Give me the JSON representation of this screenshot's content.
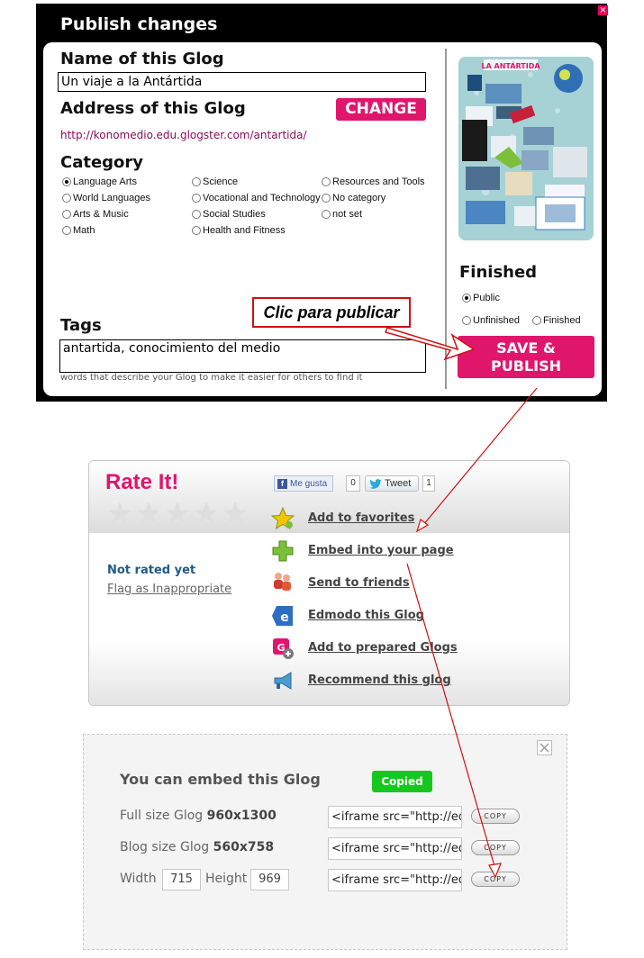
{
  "publish": {
    "title": "Publish changes",
    "close": "×",
    "name_heading": "Name of this Glog",
    "name_value": "Un viaje a la Antártida",
    "address_heading": "Address of this Glog",
    "change_label": "CHANGE",
    "address_url": "http://konomedio.edu.glogster.com/antartida/",
    "category_heading": "Category",
    "categories": [
      {
        "label": "Language Arts",
        "selected": true
      },
      {
        "label": "Science",
        "selected": false
      },
      {
        "label": "Resources and Tools",
        "selected": false
      },
      {
        "label": "World Languages",
        "selected": false
      },
      {
        "label": "Vocational and Technology",
        "selected": false
      },
      {
        "label": "No category",
        "selected": false
      },
      {
        "label": "Arts & Music",
        "selected": false
      },
      {
        "label": "Social Studies",
        "selected": false
      },
      {
        "label": "not set",
        "selected": false
      },
      {
        "label": "Math",
        "selected": false
      },
      {
        "label": "Health and Fitness",
        "selected": false
      }
    ],
    "thumbnail_title": "LA ANTÁRTIDA",
    "finished_heading": "Finished",
    "finished_options": [
      {
        "label": "Public",
        "selected": true
      },
      {
        "label": "Unfinished",
        "selected": false
      },
      {
        "label": "Finished",
        "selected": false
      }
    ],
    "tags_heading": "Tags",
    "tags_value": "antartida, conocimiento del medio",
    "tags_hint": "words that describe your Glog to make it easier for others to find it",
    "callout": "Clic para publicar",
    "save_line1": "SAVE &",
    "save_line2": "PUBLISH"
  },
  "rate": {
    "title": "Rate It!",
    "fb_like": "Me gusta",
    "fb_count": "0",
    "tweet": "Tweet",
    "tweet_count": "1",
    "not_rated": "Not rated yet",
    "flag": "Flag as Inappropriate",
    "actions": [
      {
        "label": "Add to favorites",
        "icon": "star-icon"
      },
      {
        "label": "Embed into your page",
        "icon": "plus-icon"
      },
      {
        "label": "Send to friends",
        "icon": "friends-icon"
      },
      {
        "label": "Edmodo this Glog",
        "icon": "edmodo-icon"
      },
      {
        "label": "Add to prepared Glogs",
        "icon": "prepared-glogs-icon"
      },
      {
        "label": "Recommend this glog",
        "icon": "megaphone-icon"
      }
    ]
  },
  "embed": {
    "title": "You can embed this Glog",
    "copied": "Copied",
    "full_label": "Full size Glog",
    "full_size": "960x1300",
    "blog_label": "Blog size Glog",
    "blog_size": "560x758",
    "width_label": "Width",
    "width_value": "715",
    "height_label": "Height",
    "height_value": "969",
    "code": "<iframe src=\"http://edu",
    "copy_label": "COPY"
  },
  "colors": {
    "brand_pink": "#e0166c",
    "link_blue": "#1f5c86",
    "copied_green": "#16c81e",
    "arrow_red": "#d01010"
  }
}
